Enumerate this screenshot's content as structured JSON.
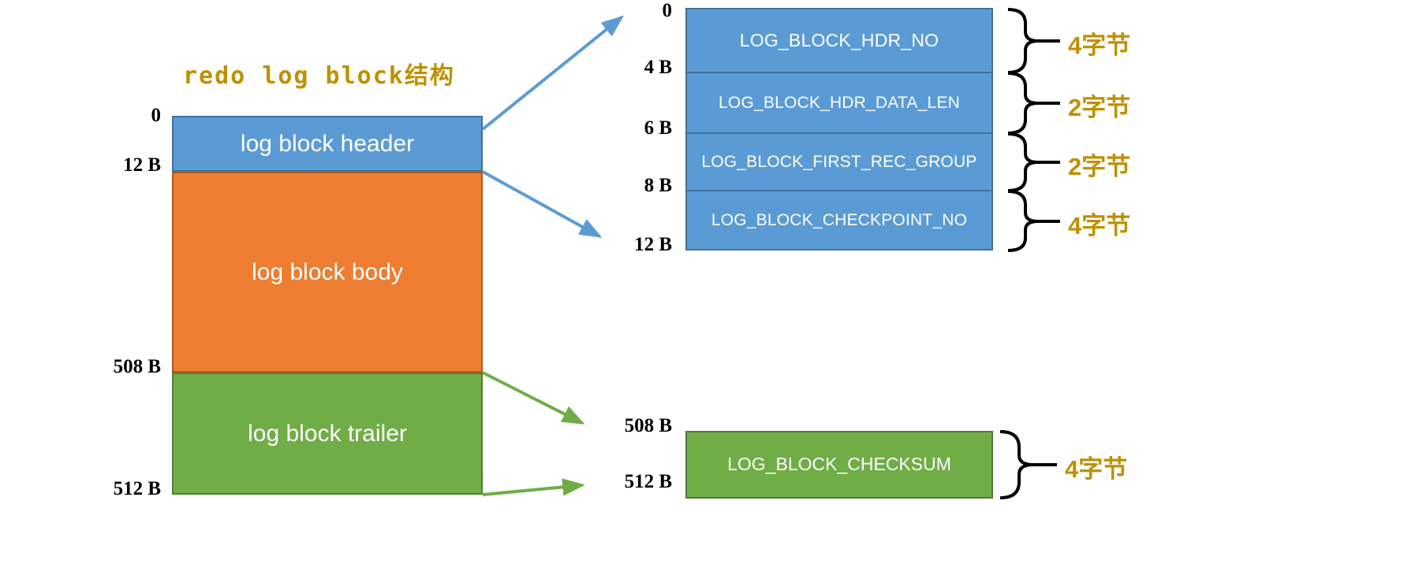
{
  "diagram": {
    "title": "redo log block结构",
    "accent_gold": "#BF9000",
    "color_header": "#5B9BD5",
    "color_body": "#ED7D31",
    "color_trailer": "#70AD47"
  },
  "main_block": {
    "offsets": {
      "top": "0",
      "header_end": "12 B",
      "body_end": "508 B",
      "bottom": "512 B"
    },
    "sections": [
      {
        "label": "log block header",
        "color": "#5B9BD5"
      },
      {
        "label": "log block body",
        "color": "#ED7D31"
      },
      {
        "label": "log block trailer",
        "color": "#70AD47"
      }
    ]
  },
  "header_detail": {
    "offsets": {
      "o0": "0",
      "o4": "4 B",
      "o6": "6 B",
      "o8": "8 B",
      "o12": "12 B"
    },
    "fields": [
      {
        "name": "LOG_BLOCK_HDR_NO",
        "size": "4字节"
      },
      {
        "name": "LOG_BLOCK_HDR_DATA_LEN",
        "size": "2字节"
      },
      {
        "name": "LOG_BLOCK_FIRST_REC_GROUP",
        "size": "2字节"
      },
      {
        "name": "LOG_BLOCK_CHECKPOINT_NO",
        "size": "4字节"
      }
    ]
  },
  "trailer_detail": {
    "offsets": {
      "start": "508 B",
      "end": "512 B"
    },
    "fields": [
      {
        "name": "LOG_BLOCK_CHECKSUM",
        "size": "4字节"
      }
    ]
  }
}
